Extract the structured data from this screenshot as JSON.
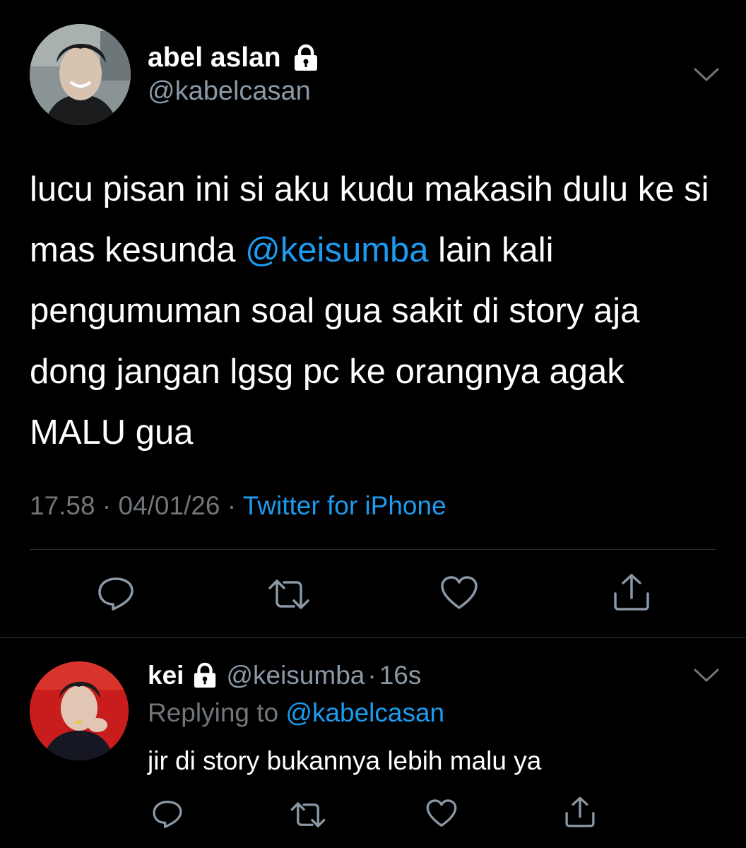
{
  "main_tweet": {
    "author_name": "abel aslan",
    "handle": "@kabelcasan",
    "text_parts": [
      "lucu pisan ini si aku kudu makasih dulu ke si mas kesunda ",
      "@keisumba",
      " lain kali pengumuman soal gua sakit di story aja dong jangan lgsg pc ke orangnya agak MALU gua"
    ],
    "time": "17.58",
    "separator": "·",
    "date": "04/01/26",
    "source": "Twitter for iPhone",
    "icons": {
      "lock": "lock-icon",
      "more": "chevron-down-icon",
      "reply": "reply-icon",
      "retweet": "retweet-icon",
      "like": "heart-icon",
      "share": "share-icon"
    }
  },
  "reply_tweet": {
    "author_name": "kei",
    "handle": "@keisumba",
    "separator": "·",
    "time": "16s",
    "replying_label": "Replying to ",
    "replying_to": "@kabelcasan",
    "text": "jir di story bukannya lebih malu ya"
  },
  "colors": {
    "background": "#000000",
    "text": "#ffffff",
    "secondary": "#8b98a5",
    "accent": "#1d9bf0",
    "divider": "#2f3336"
  }
}
